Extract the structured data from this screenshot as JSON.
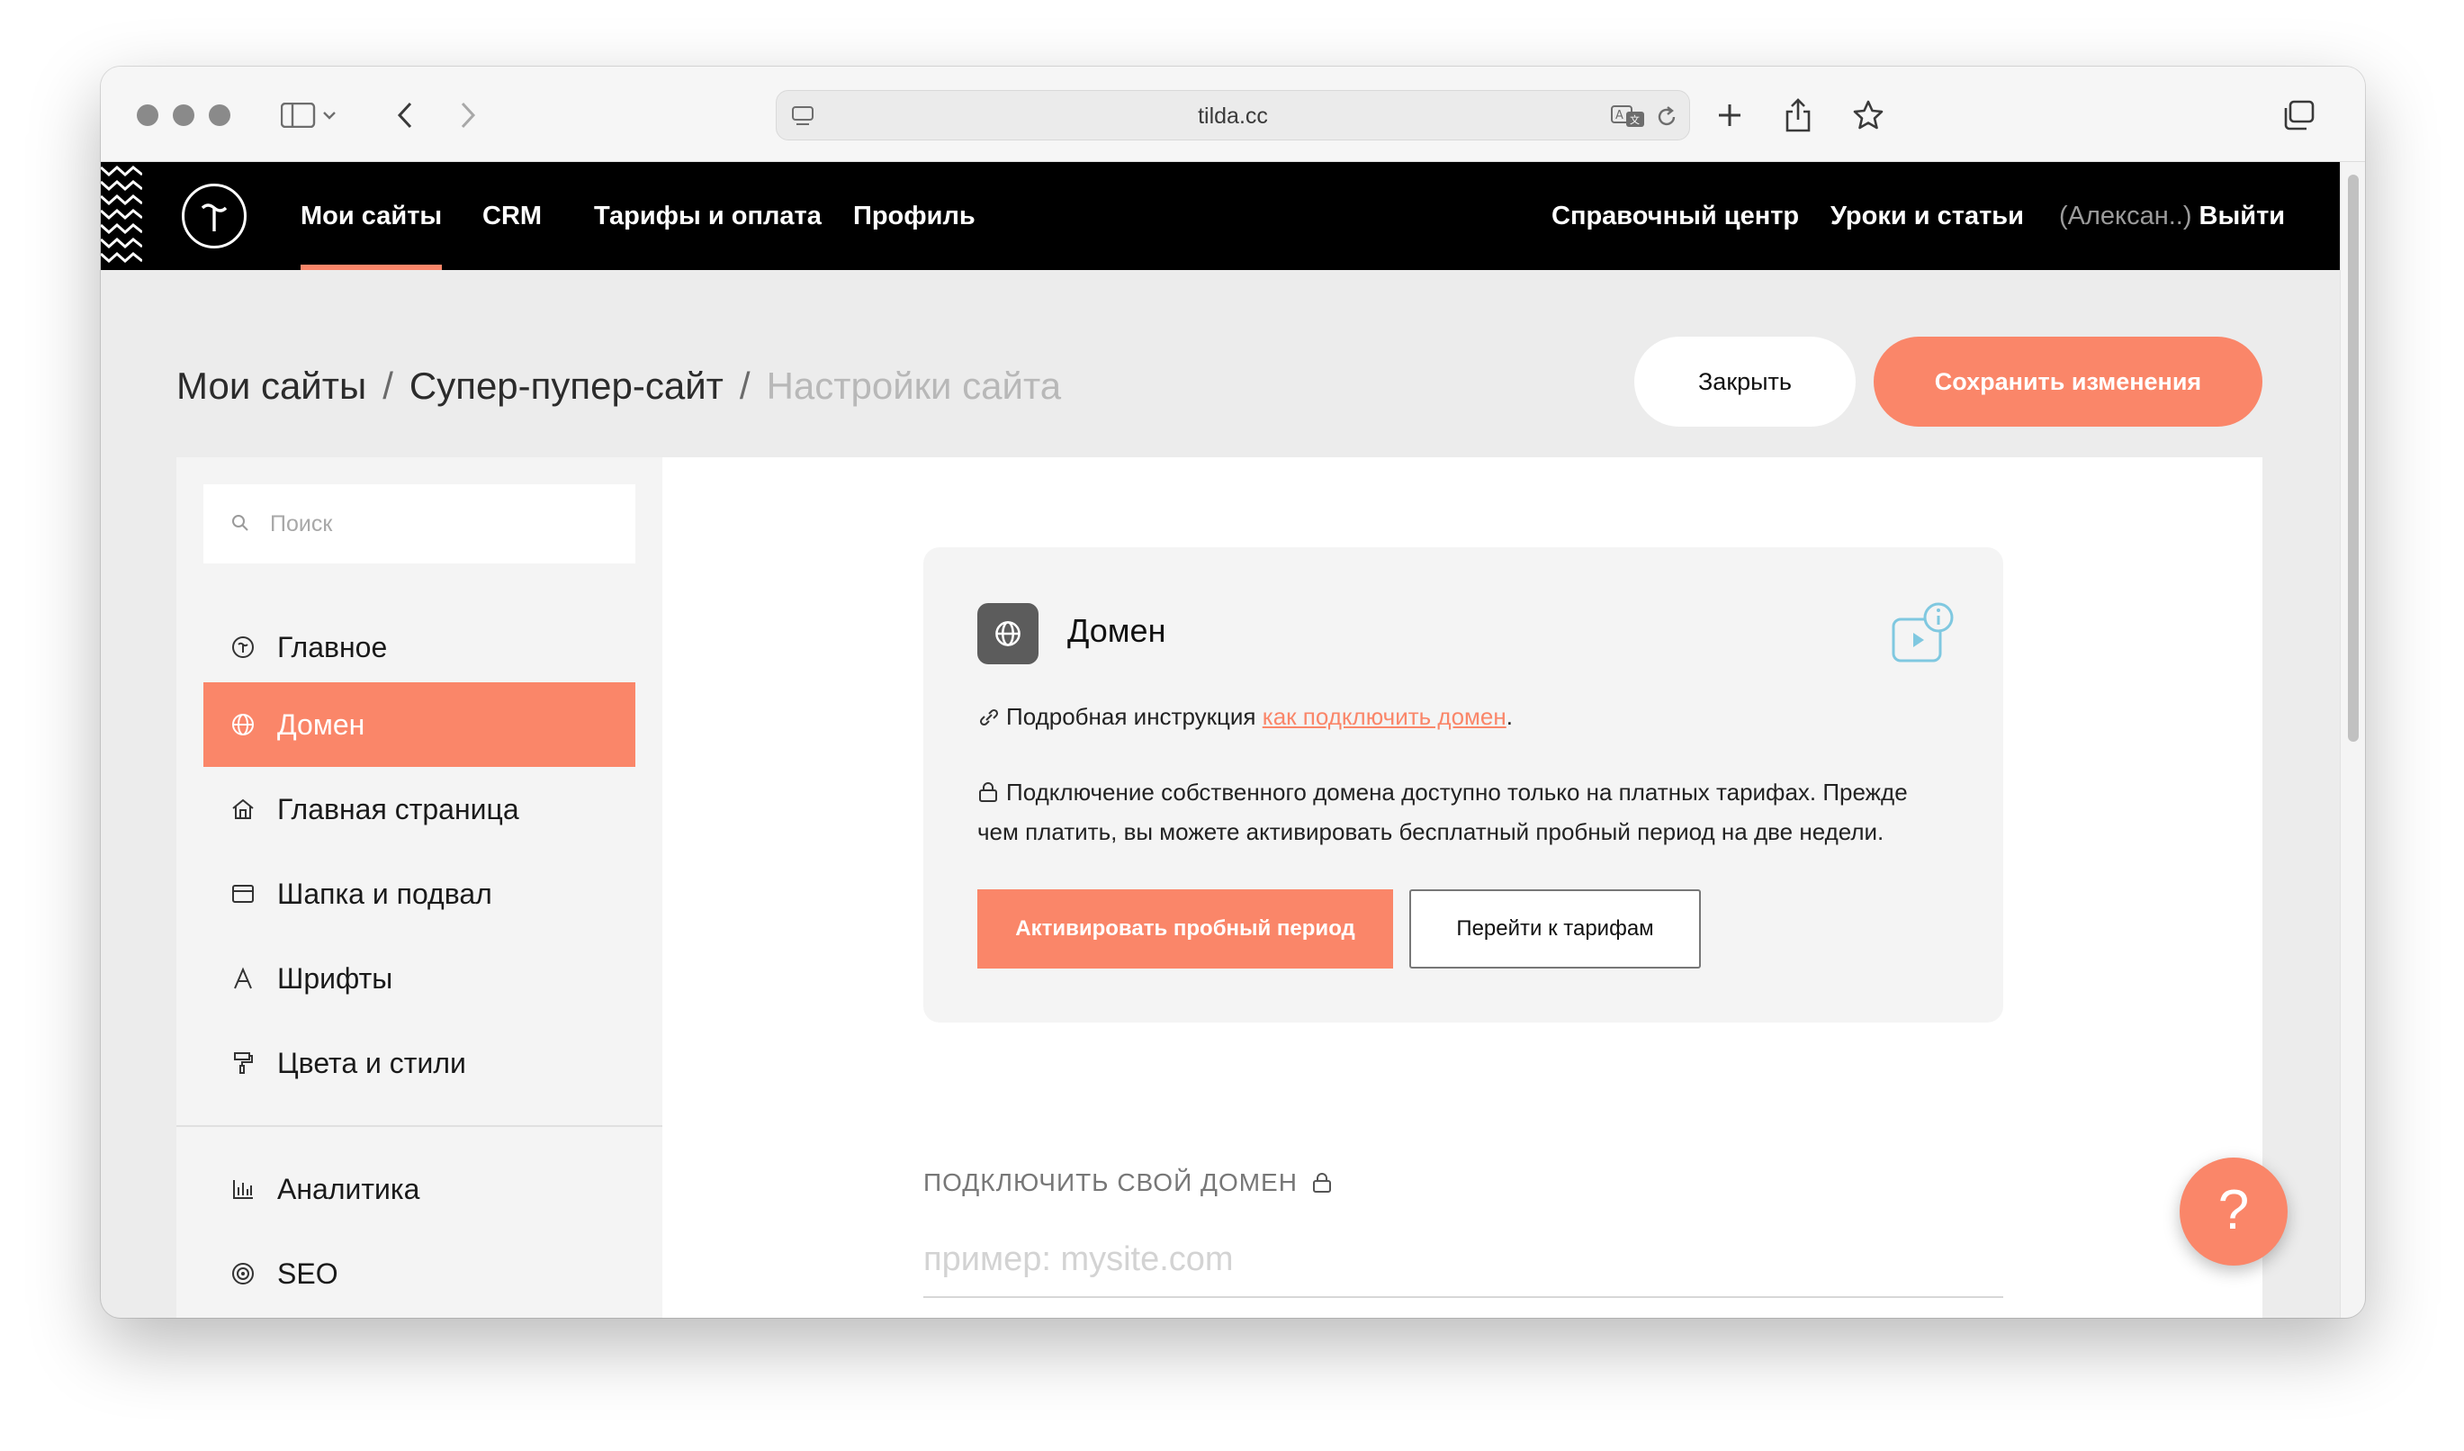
{
  "browser": {
    "url": "tilda.cc"
  },
  "nav": {
    "items": [
      {
        "label": "Мои сайты",
        "active": true
      },
      {
        "label": "CRM"
      },
      {
        "label": "Тарифы и оплата"
      },
      {
        "label": "Профиль"
      }
    ],
    "right": {
      "help_center": "Справочный центр",
      "lessons": "Уроки и статьи",
      "user": "(Алексан..)",
      "logout": "Выйти"
    }
  },
  "breadcrumb": {
    "root": "Мои сайты",
    "site": "Супер-пупер-сайт",
    "current": "Настройки сайта",
    "separator": "/"
  },
  "actions": {
    "close": "Закрыть",
    "save": "Сохранить изменения"
  },
  "sidebar": {
    "search_placeholder": "Поиск",
    "items": [
      {
        "label": "Главное",
        "icon": "tilda-circle-icon"
      },
      {
        "label": "Домен",
        "icon": "globe-icon",
        "active": true
      },
      {
        "label": "Главная страница",
        "icon": "home-icon"
      },
      {
        "label": "Шапка и подвал",
        "icon": "header-footer-icon"
      },
      {
        "label": "Шрифты",
        "icon": "font-icon"
      },
      {
        "label": "Цвета и стили",
        "icon": "paint-roller-icon"
      },
      {
        "label": "Аналитика",
        "icon": "analytics-icon"
      },
      {
        "label": "SEO",
        "icon": "target-icon"
      }
    ]
  },
  "domain_card": {
    "title": "Домен",
    "instruction_prefix": "Подробная инструкция",
    "instruction_link": "как подключить домен",
    "instruction_suffix": ".",
    "notice_line1": "Подключение собственного домена доступно только на платных тарифах. Прежде",
    "notice_line2": "чем платить, вы можете активировать бесплатный пробный период на две недели.",
    "btn_trial": "Активировать пробный период",
    "btn_tariffs": "Перейти к тарифам"
  },
  "own_domain": {
    "label": "ПОДКЛЮЧИТЬ СВОЙ ДОМЕН",
    "placeholder": "пример: mysite.com"
  },
  "help_button": "?",
  "colors": {
    "accent": "#fa8669",
    "nav_bg": "#000000",
    "page_bg": "#ececec",
    "sidebar_bg": "#f4f4f4"
  }
}
